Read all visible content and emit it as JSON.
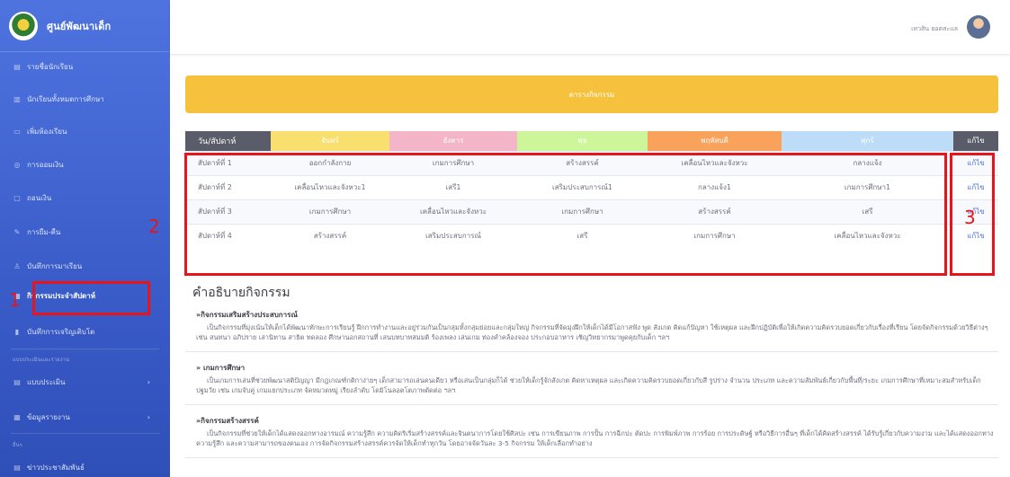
{
  "sidebar": {
    "brand": "ศูนย์พัฒนาเด็ก",
    "items": [
      {
        "label": "รายชื่อนักเรียน",
        "icon": "list-icon",
        "glyph": "▤"
      },
      {
        "label": "นักเรียนทั้งหมดการศึกษา",
        "icon": "book-icon",
        "glyph": "▥"
      },
      {
        "label": "เพิ่มห้องเรียน",
        "icon": "classroom-icon",
        "glyph": "▭"
      },
      {
        "label": "การออมเงิน",
        "icon": "savings-icon",
        "glyph": "◎"
      },
      {
        "label": "ถอนเงิน",
        "icon": "withdraw-icon",
        "glyph": "▢"
      },
      {
        "label": "การยืม-คืน",
        "icon": "pencil-icon",
        "glyph": "✎"
      },
      {
        "label": "บันทึกการมาเรียน",
        "icon": "user-check-icon",
        "glyph": "♙"
      },
      {
        "label": "กิจกรรมประจำสัปดาห์",
        "icon": "calendar-icon",
        "glyph": "▦"
      },
      {
        "label": "บันทึกการเจริญเติบโต",
        "icon": "chart-icon",
        "glyph": "▮"
      }
    ],
    "heading1": "แบบประเมินและรายงาน",
    "items2": [
      {
        "label": "แบบประเมิน",
        "icon": "form-icon",
        "glyph": "▤"
      },
      {
        "label": "ข้อมูลรายงาน",
        "icon": "report-icon",
        "glyph": "▦"
      }
    ],
    "heading2": "อื่นๆ",
    "items3": [
      {
        "label": "ข่าวประชาสัมพันธ์",
        "icon": "news-icon",
        "glyph": "▤"
      }
    ]
  },
  "topbar": {
    "user_name": "เทวสิน ยอดสะแล"
  },
  "banner": "ตารางกิจกรรม",
  "table": {
    "headers": [
      "วัน/สัปดาห์",
      "จันทร์",
      "อังคาร",
      "พุธ",
      "พฤหัสบดี",
      "ศุกร์",
      "แก้ไข"
    ],
    "rows": [
      [
        "สัปดาห์ที่ 1",
        "ออกกำลังกาย",
        "เกมการศึกษา",
        "สร้างสรรค์",
        "เคลื่อนไหวและจังหวะ",
        "กลางแจ้ง",
        "แก้ไข"
      ],
      [
        "สัปดาห์ที่ 2",
        "เคลื่อนไหวและจังหวะ1",
        "เสรี1",
        "เสริมประสบการณ์1",
        "กลางแจ้ง1",
        "เกมการศึกษา1",
        "แก้ไข"
      ],
      [
        "สัปดาห์ที่ 3",
        "เกมการศึกษา",
        "เคลื่อนไหวและจังหวะ",
        "เกมการศึกษา",
        "สร้างสรรค์",
        "เสรี",
        "แก้ไข"
      ],
      [
        "สัปดาห์ที่ 4",
        "สร้างสรรค์",
        "เสริมประสบการณ์",
        "เสรี",
        "เกมการศึกษา",
        "เคลื่อนไหวและจังหวะ",
        "แก้ไข"
      ]
    ]
  },
  "annotations": {
    "n1": "1",
    "n2": "2",
    "n3": "3"
  },
  "description": {
    "title": "คำอธิบายกิจกรรม",
    "items": [
      {
        "title": "»กิจกรรมเสริมสร้างประสบการณ์",
        "body": "เป็นกิจกรรมที่มุ่งเน้นให้เด็กได้พัฒนาทักษะการเรียนรู้ ฝึกการทำงานและอยู่ร่วมกันเป็นกลุ่มทั้งกลุ่มย่อยและกลุ่มใหญ่ กิจกรรมที่จัดมุ่งฝึกให้เด็กได้มีโอกาสฟัง พูด สังเกต คิดแก้ปัญหา ใช้เหตุผล และฝึกปฏิบัติเพื่อให้เกิดความคิดรวบยอดเกี่ยวกับเรื่องที่เรียน โดยจัดกิจกรรมด้วยวิธีต่างๆ เช่น สนทนา อภิปราย เล่านิทาน สาธิต ทดลอง ศึกษานอกสถานที่ เล่นบทบาทสมมติ ร้องเพลง เล่นเกม ท่องคำคล้องจอง ประกอบอาหาร เชิญวิทยากรมาพูดคุยกับเด็ก ฯลฯ"
      },
      {
        "title": "» เกมการศึกษา",
        "body": "เป็นเกมการเล่นที่ช่วยพัฒนาสติปัญญา มีกฎเกณฑ์กติกาง่ายๆ เด็กสามารถเล่นคนเดียว หรือเล่นเป็นกลุ่มก็ได้ ช่วยให้เด็กรู้จักสังเกต คิดหาเหตุผล และเกิดความคิดรวบยอดเกี่ยวกับสี รูปร่าง จำนวน ประเภท และความสัมพันธ์เกี่ยวกับพื้นที่/ระยะ เกมการศึกษาที่เหมาะสมสำหรับเด็กปฐมวัย เช่น เกมจับคู่ เกมแยกประเภท จัดหมวดหมู่ เรียงลำดับ โดมิโนลอตโตภาพตัดต่อ ฯลฯ"
      },
      {
        "title": "»กิจกรรมสร้างสรรค์",
        "body": "เป็นกิจกรรมที่ช่วยให้เด็กได้แสดงออกทางอารมณ์ ความรู้สึก ความคิดริเริ่มสร้างสรรค์และจินตนาการโดยใช้ศิลปะ เช่น การเขียนภาพ การปั้น การฉีกปะ ตัดปะ การพิมพ์ภาพ การร้อย การประดิษฐ์ หรือวิธีการอื่นๆ ที่เด็กได้คิดสร้างสรรค์ ได้รับรู้เกี่ยวกับความงาม และได้แสดงออกทางความรู้สึก และความสามารถของตนเอง การจัดกิจกรรมสร้างสรรค์ควรจัดให้เด็กทำทุกวัน โดยอาจจัดวันละ 3-5 กิจกรรม ให้เด็กเลือกทำอย่าง"
      }
    ]
  },
  "colors": {
    "sidebar": "#4e73df",
    "banner": "#f6c23e",
    "highlight": "#e8141c"
  }
}
